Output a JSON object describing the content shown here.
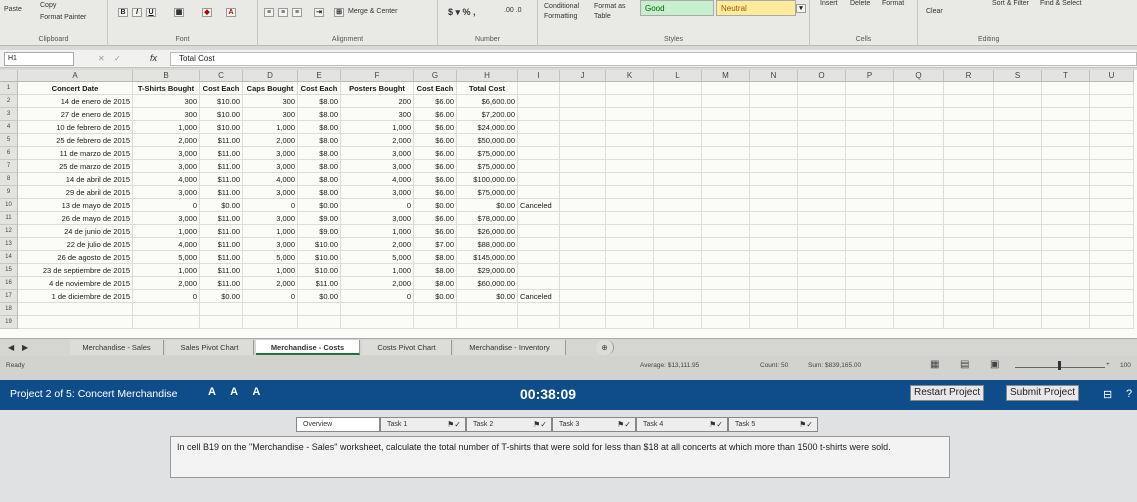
{
  "ribbon": {
    "paste": "Paste",
    "copy": "Copy",
    "format_painter": "Format Painter",
    "groups": [
      "Clipboard",
      "Font",
      "Alignment",
      "Number",
      "Styles",
      "Cells",
      "Editing"
    ],
    "merge_center": "Merge & Center",
    "conditional_formatting": "Conditional Formatting",
    "format_as_table": "Format as Table",
    "style_good": "Good",
    "style_neutral": "Neutral",
    "insert": "Insert",
    "delete": "Delete",
    "format": "Format",
    "clear": "Clear",
    "sort_filter": "Sort & Filter",
    "find_select": "Find & Select",
    "colors": {
      "good_bg": "#c6efce",
      "neutral_bg": "#ffeb9c"
    }
  },
  "formula_bar": {
    "name_box": "H1",
    "fx": "fx",
    "content": "Total Cost"
  },
  "grid": {
    "columns": [
      "A",
      "B",
      "C",
      "D",
      "E",
      "F",
      "G",
      "H",
      "I",
      "J",
      "K",
      "L",
      "M",
      "N",
      "O",
      "P",
      "Q",
      "R",
      "S",
      "T",
      "U"
    ],
    "headers": [
      "Concert Date",
      "T-Shirts Bought",
      "Cost Each",
      "Caps Bought",
      "Cost Each",
      "Posters Bought",
      "Cost Each",
      "Total Cost"
    ],
    "rows": [
      [
        "14 de enero de 2015",
        "300",
        "$10.00",
        "300",
        "$8.00",
        "200",
        "$6.00",
        "$6,600.00",
        ""
      ],
      [
        "27 de enero de 2015",
        "300",
        "$10.00",
        "300",
        "$8.00",
        "300",
        "$6.00",
        "$7,200.00",
        ""
      ],
      [
        "10 de febrero de 2015",
        "1,000",
        "$10.00",
        "1,000",
        "$8.00",
        "1,000",
        "$6.00",
        "$24,000.00",
        ""
      ],
      [
        "25 de febrero de 2015",
        "2,000",
        "$11.00",
        "2,000",
        "$8.00",
        "2,000",
        "$6.00",
        "$50,000.00",
        ""
      ],
      [
        "11 de marzo de 2015",
        "3,000",
        "$11.00",
        "3,000",
        "$8.00",
        "3,000",
        "$6.00",
        "$75,000.00",
        ""
      ],
      [
        "25 de marzo de 2015",
        "3,000",
        "$11.00",
        "3,000",
        "$8.00",
        "3,000",
        "$6.00",
        "$75,000.00",
        ""
      ],
      [
        "14 de abril de 2015",
        "4,000",
        "$11.00",
        "4,000",
        "$8.00",
        "4,000",
        "$6.00",
        "$100,000.00",
        ""
      ],
      [
        "29 de abril de 2015",
        "3,000",
        "$11.00",
        "3,000",
        "$8.00",
        "3,000",
        "$6.00",
        "$75,000.00",
        ""
      ],
      [
        "13 de mayo de 2015",
        "0",
        "$0.00",
        "0",
        "$0.00",
        "0",
        "$0.00",
        "$0.00",
        "Canceled"
      ],
      [
        "26 de mayo de 2015",
        "3,000",
        "$11.00",
        "3,000",
        "$9.00",
        "3,000",
        "$6.00",
        "$78,000.00",
        ""
      ],
      [
        "24 de junio de 2015",
        "1,000",
        "$11.00",
        "1,000",
        "$9.00",
        "1,000",
        "$6.00",
        "$26,000.00",
        ""
      ],
      [
        "22 de julio de 2015",
        "4,000",
        "$11.00",
        "3,000",
        "$10.00",
        "2,000",
        "$7.00",
        "$88,000.00",
        ""
      ],
      [
        "26 de agosto de 2015",
        "5,000",
        "$11.00",
        "5,000",
        "$10.00",
        "5,000",
        "$8.00",
        "$145,000.00",
        ""
      ],
      [
        "23 de septiembre de 2015",
        "1,000",
        "$11.00",
        "1,000",
        "$10.00",
        "1,000",
        "$8.00",
        "$29,000.00",
        ""
      ],
      [
        "4 de noviembre de 2015",
        "2,000",
        "$11.00",
        "2,000",
        "$11.00",
        "2,000",
        "$8.00",
        "$60,000.00",
        ""
      ],
      [
        "1 de diciembre de 2015",
        "0",
        "$0.00",
        "0",
        "$0.00",
        "0",
        "$0.00",
        "$0.00",
        "Canceled"
      ]
    ]
  },
  "sheet_tabs": [
    "Merchandise - Sales",
    "Sales Pivot Chart",
    "Merchandise - Costs",
    "Costs Pivot Chart",
    "Merchandise - Inventory"
  ],
  "active_tab": "Merchandise - Costs",
  "status_bar": {
    "ready": "Ready",
    "average": "Average: $13,111.95",
    "count": "Count: 50",
    "sum": "Sum: $839,165.00",
    "zoom": "100"
  },
  "exam": {
    "project": "Project 2 of 5: Concert Merchandise",
    "font_sizes": "A A A",
    "timer": "00:38:09",
    "restart": "Restart Project",
    "submit": "Submit Project",
    "tabs": [
      "Overview",
      "Task 1",
      "Task 2",
      "Task 3",
      "Task 4",
      "Task 5"
    ],
    "instruction": "In cell B19 on the \"Merchandise - Sales\" worksheet, calculate the total number of T-shirts that were sold for less than $18 at all concerts at which more than 1500 t-shirts were sold."
  }
}
